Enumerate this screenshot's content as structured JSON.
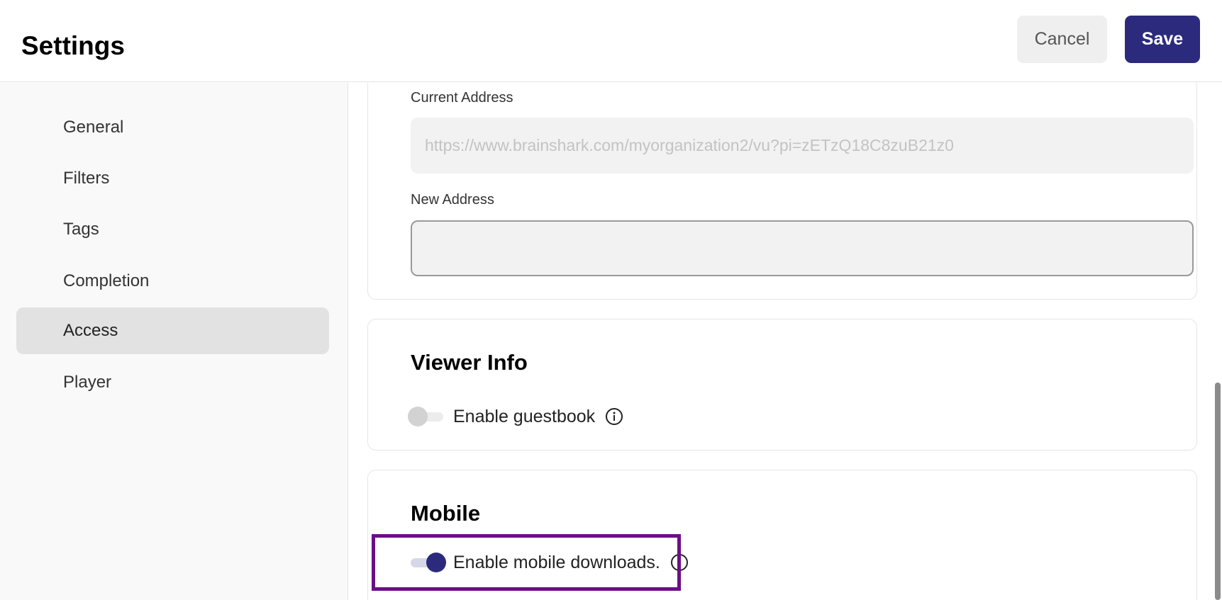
{
  "header": {
    "title": "Settings",
    "cancel_label": "Cancel",
    "save_label": "Save"
  },
  "sidebar": {
    "items": [
      {
        "label": "General",
        "active": false
      },
      {
        "label": "Filters",
        "active": false
      },
      {
        "label": "Tags",
        "active": false
      },
      {
        "label": "Completion",
        "active": false
      },
      {
        "label": "Access",
        "active": true
      },
      {
        "label": "Player",
        "active": false
      }
    ]
  },
  "address": {
    "current_label": "Current Address",
    "current_placeholder": "https://www.brainshark.com/myorganization2/vu?pi=zETzQ18C8zuB21z0",
    "new_label": "New Address",
    "new_value": ""
  },
  "viewer_info": {
    "title": "Viewer Info",
    "guestbook_label": "Enable guestbook",
    "guestbook_enabled": false
  },
  "mobile": {
    "title": "Mobile",
    "downloads_label": "Enable mobile downloads.",
    "downloads_enabled": true
  },
  "colors": {
    "accent": "#2b2a7c",
    "highlight": "#6b0f85"
  },
  "icons": {
    "info": "info-circle-icon"
  }
}
